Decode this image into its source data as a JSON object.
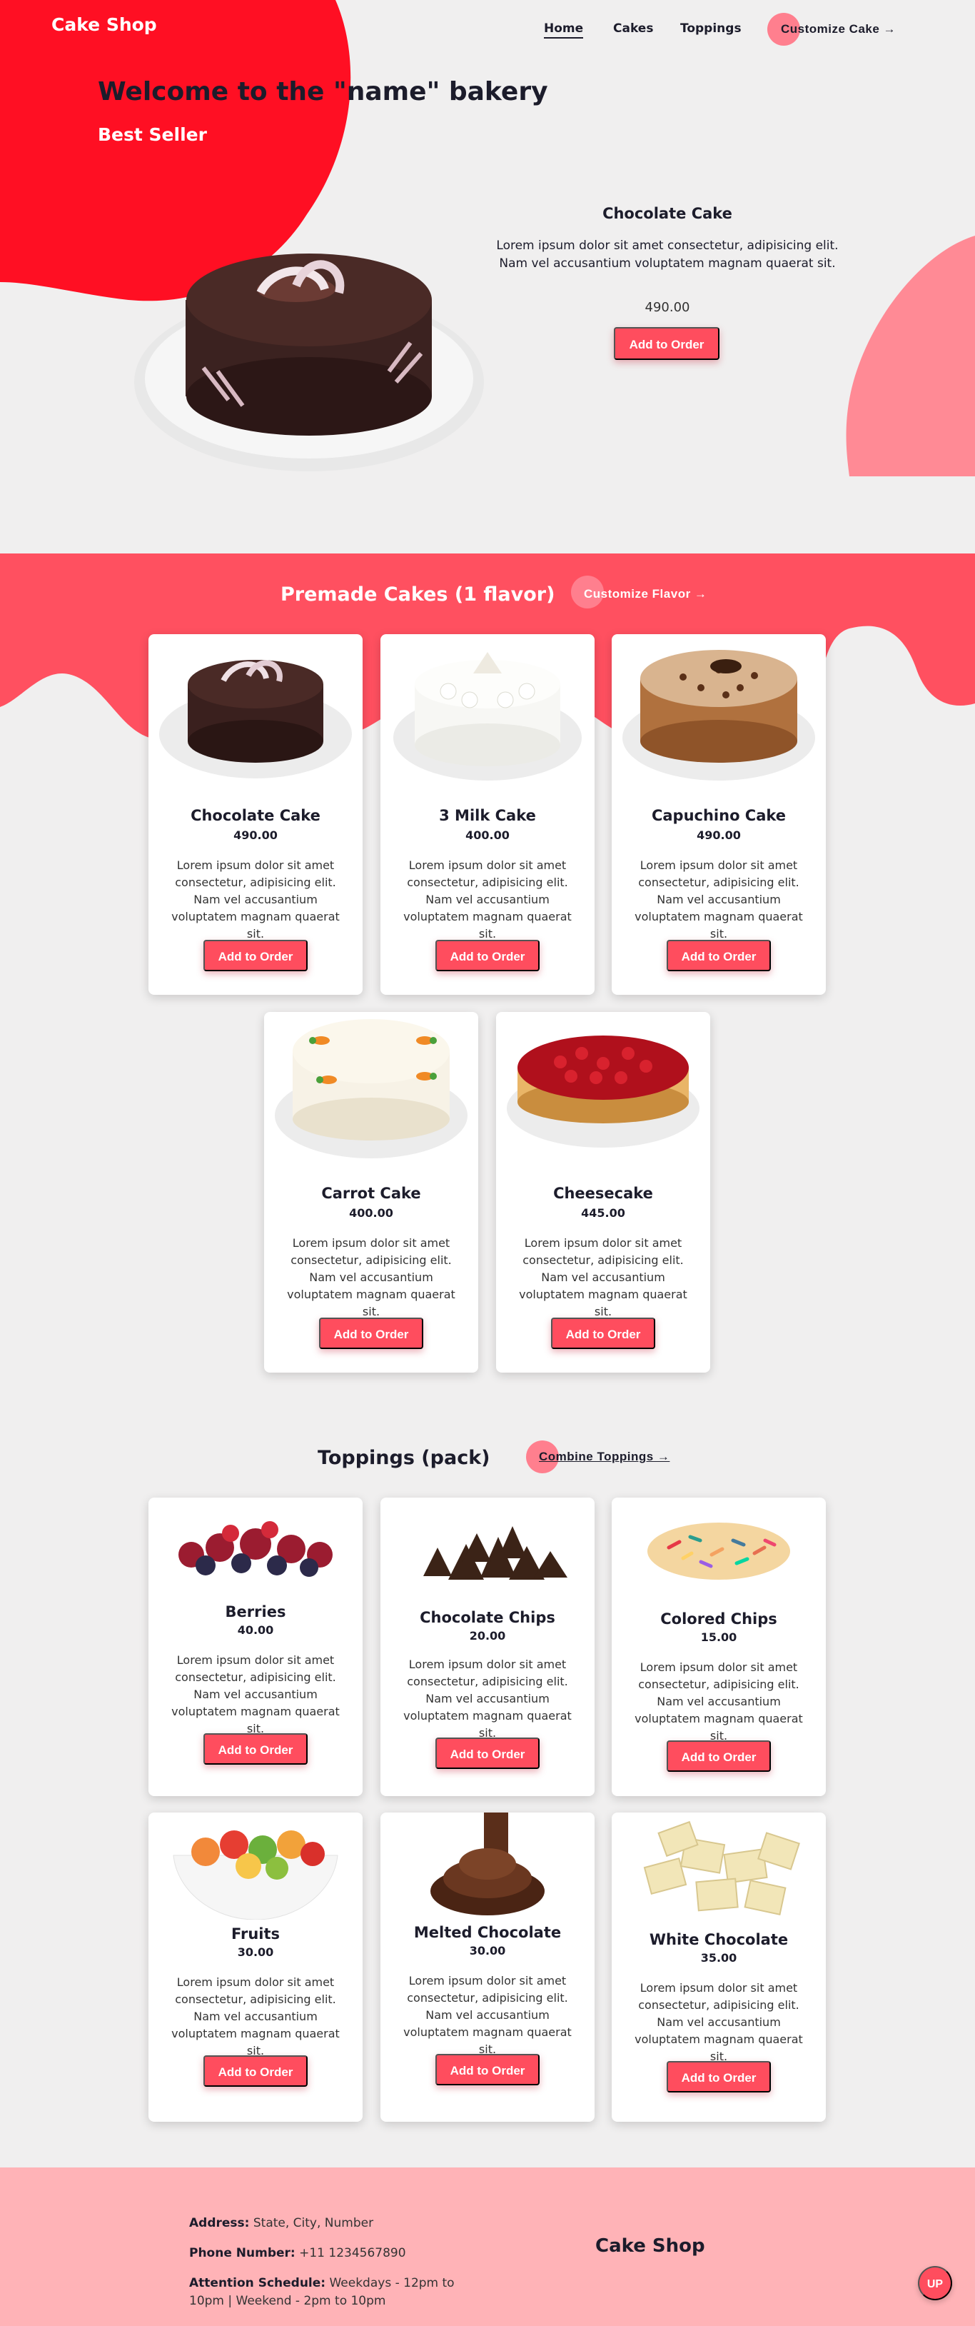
{
  "header": {
    "brand": "Cake Shop",
    "nav": [
      {
        "label": "Home"
      },
      {
        "label": "Cakes"
      },
      {
        "label": "Toppings"
      }
    ],
    "customize_label": "Customize Cake →"
  },
  "hero": {
    "title": "Welcome to the \"name\" bakery",
    "subtitle": "Best Seller",
    "featured": {
      "name": "Chocolate Cake",
      "description": "Lorem ipsum dolor sit amet consectetur, adipisicing elit. Nam vel accusantium voluptatem magnam quaerat sit.",
      "price": "490.00",
      "button": "Add to Order"
    }
  },
  "premade": {
    "title": "Premade Cakes (1 flavor)",
    "link": "Customize Flavor →",
    "items": [
      {
        "name": "Chocolate Cake",
        "price": "490.00",
        "description": "Lorem ipsum dolor sit amet consectetur, adipisicing elit. Nam vel accusantium voluptatem magnam quaerat sit.",
        "button": "Add to Order",
        "image": "chocolate-cake"
      },
      {
        "name": "3 Milk Cake",
        "price": "400.00",
        "description": "Lorem ipsum dolor sit amet consectetur, adipisicing elit. Nam vel accusantium voluptatem magnam quaerat sit.",
        "button": "Add to Order",
        "image": "three-milk-cake"
      },
      {
        "name": "Capuchino Cake",
        "price": "490.00",
        "description": "Lorem ipsum dolor sit amet consectetur, adipisicing elit. Nam vel accusantium voluptatem magnam quaerat sit.",
        "button": "Add to Order",
        "image": "capuchino-cake"
      },
      {
        "name": "Carrot Cake",
        "price": "400.00",
        "description": "Lorem ipsum dolor sit amet consectetur, adipisicing elit. Nam vel accusantium voluptatem magnam quaerat sit.",
        "button": "Add to Order",
        "image": "carrot-cake"
      },
      {
        "name": "Cheesecake",
        "price": "445.00",
        "description": "Lorem ipsum dolor sit amet consectetur, adipisicing elit. Nam vel accusantium voluptatem magnam quaerat sit.",
        "button": "Add to Order",
        "image": "cheesecake"
      }
    ]
  },
  "toppings": {
    "title": "Toppings (pack)",
    "link": "Combine Toppings →",
    "items": [
      {
        "name": "Berries",
        "price": "40.00",
        "description": "Lorem ipsum dolor sit amet consectetur, adipisicing elit. Nam vel accusantium voluptatem magnam quaerat sit.",
        "button": "Add to Order",
        "image": "berries"
      },
      {
        "name": "Chocolate Chips",
        "price": "20.00",
        "description": "Lorem ipsum dolor sit amet consectetur, adipisicing elit. Nam vel accusantium voluptatem magnam quaerat sit.",
        "button": "Add to Order",
        "image": "chocolate-chips"
      },
      {
        "name": "Colored Chips",
        "price": "15.00",
        "description": "Lorem ipsum dolor sit amet consectetur, adipisicing elit. Nam vel accusantium voluptatem magnam quaerat sit.",
        "button": "Add to Order",
        "image": "colored-chips"
      },
      {
        "name": "Fruits",
        "price": "30.00",
        "description": "Lorem ipsum dolor sit amet consectetur, adipisicing elit. Nam vel accusantium voluptatem magnam quaerat sit.",
        "button": "Add to Order",
        "image": "fruits"
      },
      {
        "name": "Melted Chocolate",
        "price": "30.00",
        "description": "Lorem ipsum dolor sit amet consectetur, adipisicing elit. Nam vel accusantium voluptatem magnam quaerat sit.",
        "button": "Add to Order",
        "image": "melted-chocolate"
      },
      {
        "name": "White Chocolate",
        "price": "35.00",
        "description": "Lorem ipsum dolor sit amet consectetur, adipisicing elit. Nam vel accusantium voluptatem magnam quaerat sit.",
        "button": "Add to Order",
        "image": "white-chocolate"
      }
    ]
  },
  "footer": {
    "address_label": "Address:",
    "address_value": "State, City, Number",
    "phone_label": "Phone Number:",
    "phone_value": "+11 1234567890",
    "schedule_label": "Attention Schedule:",
    "schedule_value": "Weekdays - 12pm to 10pm | Weekend - 2pm to 10pm",
    "brand": "Cake Shop",
    "up_label": "UP"
  },
  "colors": {
    "accent": "#ff4d5e",
    "hero_blob": "#ff0f23",
    "band": "#ff5060",
    "footer": "#ffb3b7",
    "dark_text": "#1c1c2b"
  }
}
